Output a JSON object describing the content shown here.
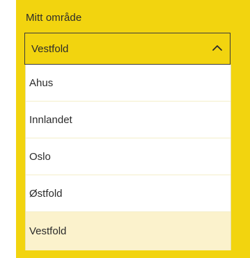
{
  "field": {
    "label": "Mitt område",
    "selected_value": "Vestfold",
    "chevron_icon": "chevron-up-icon"
  },
  "options": [
    {
      "label": "Ahus",
      "selected": false
    },
    {
      "label": "Innlandet",
      "selected": false
    },
    {
      "label": "Oslo",
      "selected": false
    },
    {
      "label": "Østfold",
      "selected": false
    },
    {
      "label": "Vestfold",
      "selected": true
    }
  ],
  "colors": {
    "panel_background": "#f2d40f",
    "selected_option_background": "#fbf2cc",
    "text": "#2b2b2b"
  }
}
